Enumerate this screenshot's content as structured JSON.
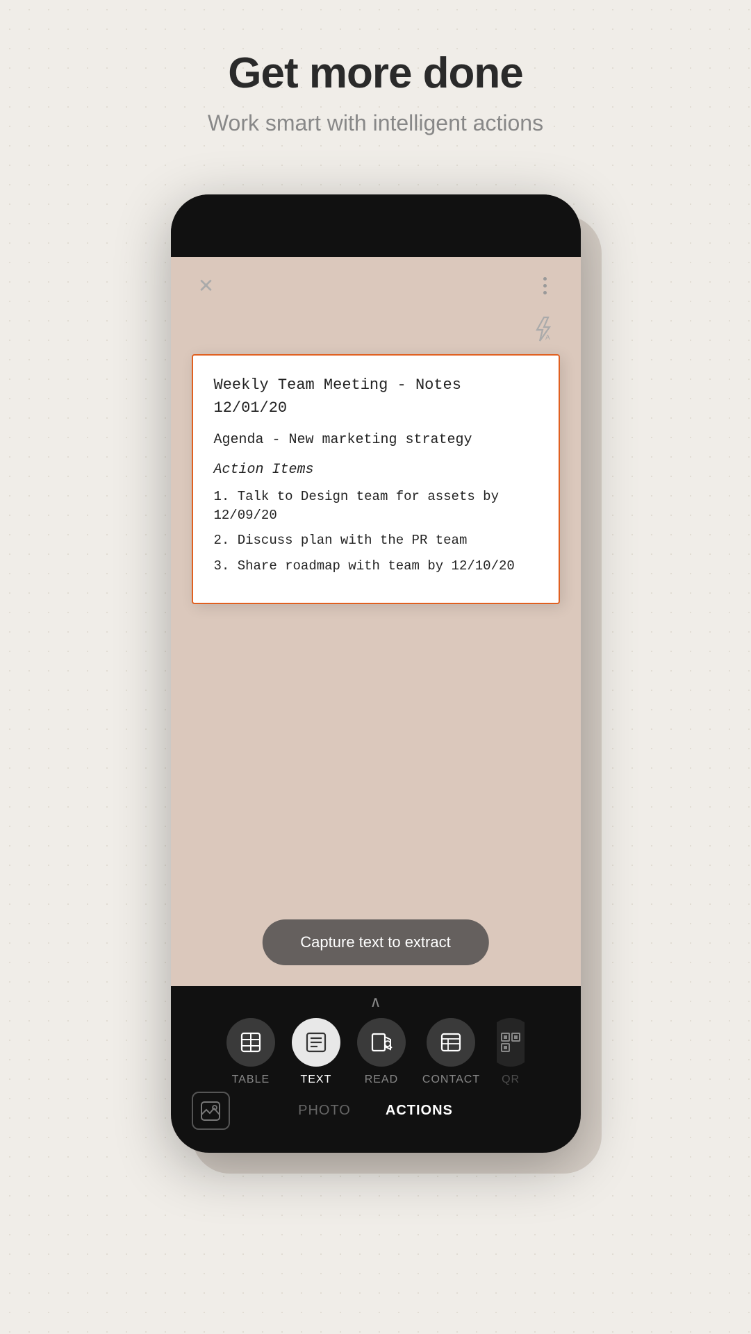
{
  "header": {
    "title": "Get more done",
    "subtitle": "Work smart with intelligent actions"
  },
  "document": {
    "title": "Weekly Team Meeting - Notes",
    "date": "12/01/20",
    "agenda": "Agenda - New marketing strategy",
    "section": "Action Items",
    "items": [
      "1. Talk to Design team for assets by 12/09/20",
      "2. Discuss plan with the PR team",
      "3. Share roadmap with team by 12/10/20"
    ]
  },
  "capture_button": "Capture text to extract",
  "modes": [
    {
      "label": "TABLE",
      "active": false
    },
    {
      "label": "TEXT",
      "active": true
    },
    {
      "label": "READ",
      "active": false
    },
    {
      "label": "CONTACT",
      "active": false
    },
    {
      "label": "QR",
      "active": false
    }
  ],
  "tabs": [
    {
      "label": "PHOTO",
      "active": false
    },
    {
      "label": "ACTIONS",
      "active": true
    }
  ],
  "icons": {
    "close": "✕",
    "more_dots": "⋮",
    "chevron_up": "∧",
    "flash_auto": "⚡A"
  }
}
